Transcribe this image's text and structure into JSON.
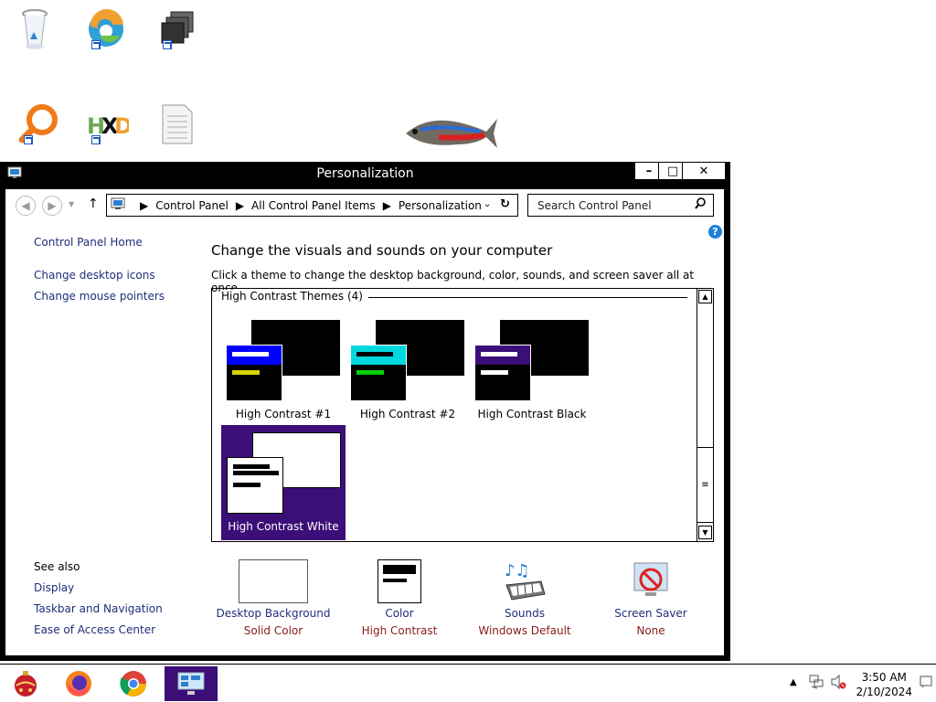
{
  "window": {
    "title": "Personalization",
    "minimize_label": "–",
    "maximize_label": "□",
    "close_label": "✕"
  },
  "address_bar": {
    "crumbs": [
      "Control Panel",
      "All Control Panel Items",
      "Personalization"
    ],
    "search_placeholder": "Search Control Panel"
  },
  "left_pane": {
    "home": "Control Panel Home",
    "links": [
      "Change desktop icons",
      "Change mouse pointers"
    ],
    "see_also_title": "See also",
    "see_also": [
      "Display",
      "Taskbar and Navigation",
      "Ease of Access Center"
    ]
  },
  "main": {
    "heading": "Change the visuals and sounds on your computer",
    "subheading": "Click a theme to change the desktop background, color, sounds, and screen saver all at once.",
    "group_label": "High Contrast Themes (4)",
    "themes": [
      {
        "label": "High Contrast #1",
        "bar_color": "#0000ff",
        "line1": "#ffffff",
        "line2": "#d4d400"
      },
      {
        "label": "High Contrast #2",
        "bar_color": "#00d8e0",
        "line1": "#000000",
        "line2": "#00d000"
      },
      {
        "label": "High Contrast Black",
        "bar_color": "#3c0e77",
        "line1": "#ffffff",
        "line2": "#ffffff"
      },
      {
        "label": "High Contrast White",
        "selected": true
      }
    ]
  },
  "settings": [
    {
      "name": "Desktop Background",
      "value": "Solid Color",
      "icon": "blank-background-icon"
    },
    {
      "name": "Color",
      "value": "High Contrast",
      "icon": "color-icon"
    },
    {
      "name": "Sounds",
      "value": "Windows Default",
      "icon": "sounds-icon"
    },
    {
      "name": "Screen Saver",
      "value": "None",
      "icon": "screen-saver-icon"
    }
  ],
  "taskbar": {
    "time": "3:50 AM",
    "date": "2/10/2024"
  },
  "colors": {
    "link": "#1f2e7a",
    "selected_theme": "#3c0e77",
    "setting_value": "#8b1a1a"
  }
}
